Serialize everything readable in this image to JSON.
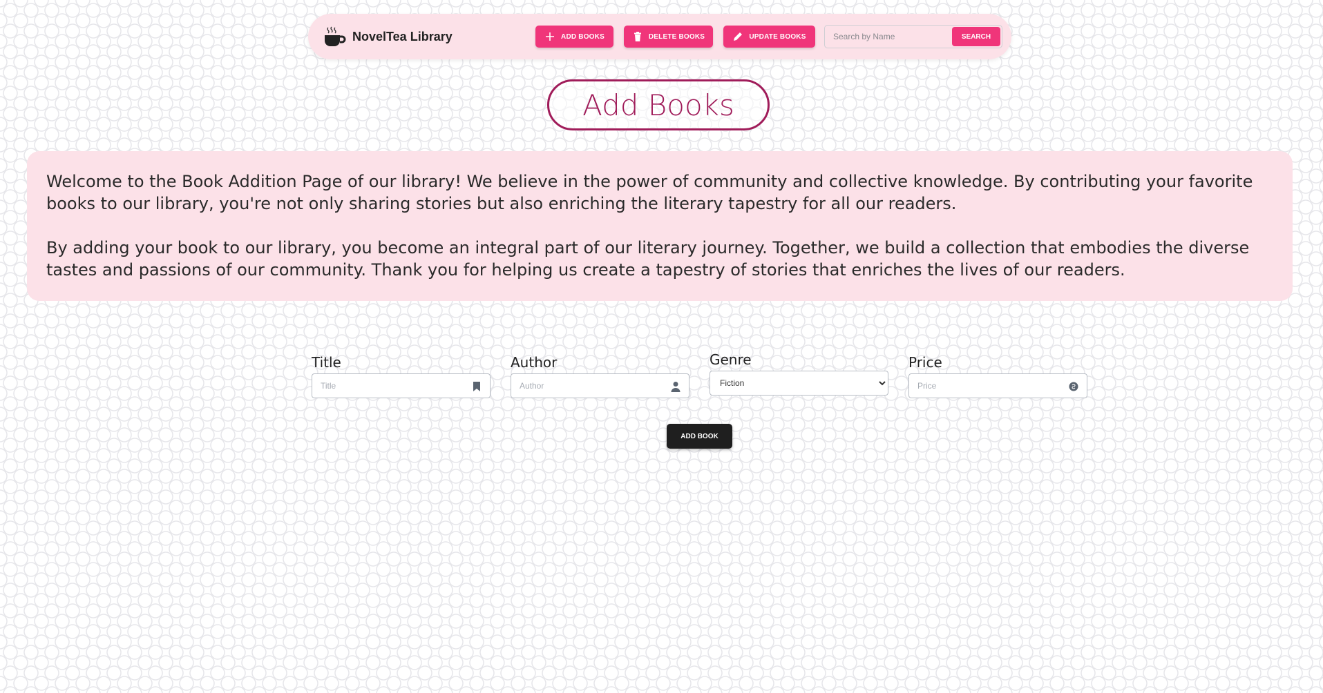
{
  "navbar": {
    "brand_name": "NovelTea Library",
    "brand_icon": "teacup-icon",
    "add_books_label": "ADD BOOKS",
    "delete_books_label": "DELETE BOOKS",
    "update_books_label": "UPDATE BOOKS",
    "search_placeholder": "Search by Name",
    "search_label": "SEARCH"
  },
  "page": {
    "title": "Add Books"
  },
  "intro": {
    "paragraph1": "Welcome to the Book Addition Page of our library! We believe in the power of community and collective knowledge. By contributing your favorite books to our library, you're not only sharing stories but also enriching the literary tapestry for all our readers.",
    "paragraph2": "By adding your book to our library, you become an integral part of our literary journey. Together, we build a collection that embodies the diverse tastes and passions of our community. Thank you for helping us create a tapestry of stories that enriches the lives of our readers."
  },
  "form": {
    "title_label": "Title",
    "title_placeholder": "Title",
    "author_label": "Author",
    "author_placeholder": "Author",
    "genre_label": "Genre",
    "genre_selected": "Fiction",
    "price_label": "Price",
    "price_placeholder": "Price",
    "submit_label": "ADD BOOK"
  },
  "colors": {
    "accent": "#f0357a",
    "title_border": "#a01c5a",
    "panel_bg": "#fce1e8",
    "dark_button": "#1f1f1f"
  }
}
